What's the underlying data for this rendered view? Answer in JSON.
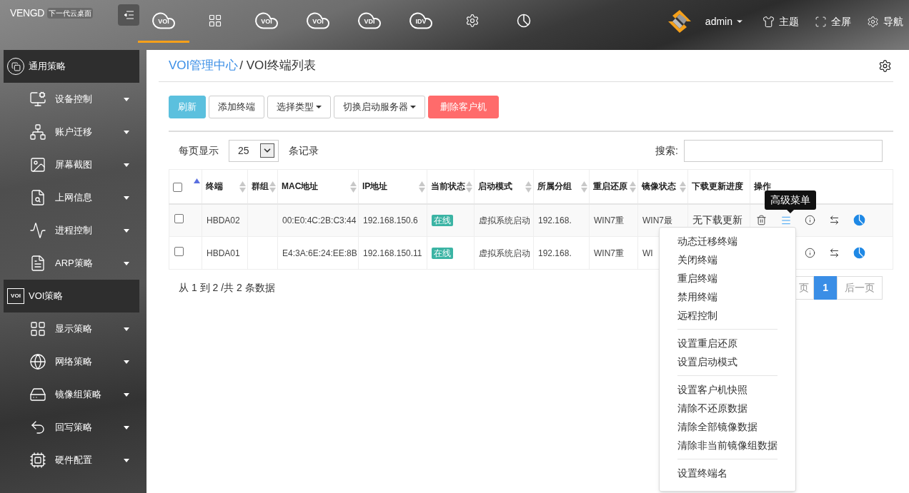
{
  "brand": {
    "name": "VENGD",
    "tagline": "下一代云桌面"
  },
  "top_nav": [
    {
      "kind": "cloud",
      "badge": "VOI",
      "selected": true
    },
    {
      "kind": "grid",
      "selected": false
    },
    {
      "kind": "cloud",
      "badge": "VOI",
      "selected": false
    },
    {
      "kind": "cloud",
      "badge": "VOI",
      "selected": false
    },
    {
      "kind": "cloud",
      "badge": "VDI",
      "selected": false
    },
    {
      "kind": "cloud",
      "badge": "IDV",
      "selected": false
    },
    {
      "kind": "gear",
      "selected": false
    },
    {
      "kind": "pie",
      "selected": false
    }
  ],
  "user": {
    "name": "admin"
  },
  "top_actions": [
    "主题",
    "全屏",
    "导航"
  ],
  "sidebar": [
    {
      "kind": "section",
      "label": "通用策略"
    },
    {
      "kind": "item",
      "label": "设备控制"
    },
    {
      "kind": "item",
      "label": "账户迁移"
    },
    {
      "kind": "item",
      "label": "屏幕截图"
    },
    {
      "kind": "item",
      "label": "上网信息"
    },
    {
      "kind": "item",
      "label": "进程控制"
    },
    {
      "kind": "item",
      "label": "ARP策略"
    },
    {
      "kind": "section",
      "label": "VOI策略",
      "badge": "VOI"
    },
    {
      "kind": "item",
      "label": "显示策略"
    },
    {
      "kind": "item",
      "label": "网络策略"
    },
    {
      "kind": "item",
      "label": "镜像组策略"
    },
    {
      "kind": "item",
      "label": "回写策略"
    },
    {
      "kind": "item",
      "label": "硬件配置"
    }
  ],
  "breadcrumb": {
    "parent": "VOI管理中心",
    "current": "/ VOI终端列表"
  },
  "toolbar": [
    {
      "label": "刷新",
      "kind": "info",
      "caret": false
    },
    {
      "label": "添加终端",
      "kind": "default",
      "caret": false
    },
    {
      "label": "选择类型",
      "kind": "default",
      "caret": true
    },
    {
      "label": "切换启动服务器",
      "kind": "default",
      "caret": true
    },
    {
      "label": "删除客户机",
      "kind": "danger",
      "caret": false
    }
  ],
  "page_size": {
    "before": "每页显示",
    "value": "25",
    "after": "条记录"
  },
  "search": {
    "label": "搜索:"
  },
  "table": {
    "select_all": {
      "checked": false
    },
    "columns": [
      {
        "sortable": true,
        "sorted": true
      },
      {
        "label": "终端",
        "sortable": true,
        "sorted": false
      },
      {
        "label": "群组",
        "sortable": true,
        "sorted": false
      },
      {
        "label": "MAC地址",
        "sortable": true,
        "sorted": false
      },
      {
        "label": "IP地址",
        "sortable": true,
        "sorted": false
      },
      {
        "label": "当前状态",
        "sortable": true,
        "sorted": false
      },
      {
        "label": "启动模式",
        "sortable": true,
        "sorted": false
      },
      {
        "label": "所属分组",
        "sortable": true,
        "sorted": false
      },
      {
        "label": "重启还原",
        "sortable": true,
        "sorted": false
      },
      {
        "label": "镜像状态",
        "sortable": true,
        "sorted": false
      },
      {
        "label": "下载更新进度",
        "sortable": false
      },
      {
        "label": "操作",
        "sortable": false
      }
    ],
    "rows": [
      {
        "checked": false,
        "terminal": "HBDA02",
        "mac": "00:E0:4C:2B:C3:44",
        "ip": "192.168.150.6",
        "status": "在线",
        "boot": "虚拟系统启动",
        "group": "192.168.",
        "restore": "WIN7重",
        "image": "WIN7最",
        "download": "无下载更新",
        "actions": [
          {
            "kind": "delete"
          },
          {
            "kind": "menu"
          },
          {
            "kind": "info"
          },
          {
            "kind": "swap"
          },
          {
            "kind": "pie"
          }
        ]
      },
      {
        "checked": false,
        "terminal": "HBDA01",
        "mac": "E4:3A:6E:24:EE:8B",
        "ip": "192.168.150.11",
        "status": "在线",
        "boot": "虚拟系统启动",
        "group": "192.168.",
        "restore": "WIN7重",
        "image": "WI",
        "actions": [
          {
            "kind": "info"
          },
          {
            "kind": "swap"
          },
          {
            "kind": "pie"
          }
        ]
      }
    ]
  },
  "summary": "从 1 到 2 /共 2 条数据",
  "pagination": [
    {
      "label": "页",
      "selected": false
    },
    {
      "label": "1",
      "selected": true
    },
    {
      "label": "后一页",
      "selected": false
    }
  ],
  "tooltip": "高级菜单",
  "context_menu": [
    [
      "动态迁移终端",
      "关闭终端",
      "重启终端",
      "禁用终端",
      "远程控制"
    ],
    [
      "设置重启还原",
      "设置启动模式"
    ],
    [
      "设置客户机快照",
      "清除不还原数据",
      "清除全部镜像数据",
      "清除非当前镜像组数据"
    ],
    [
      "设置终端名"
    ]
  ]
}
